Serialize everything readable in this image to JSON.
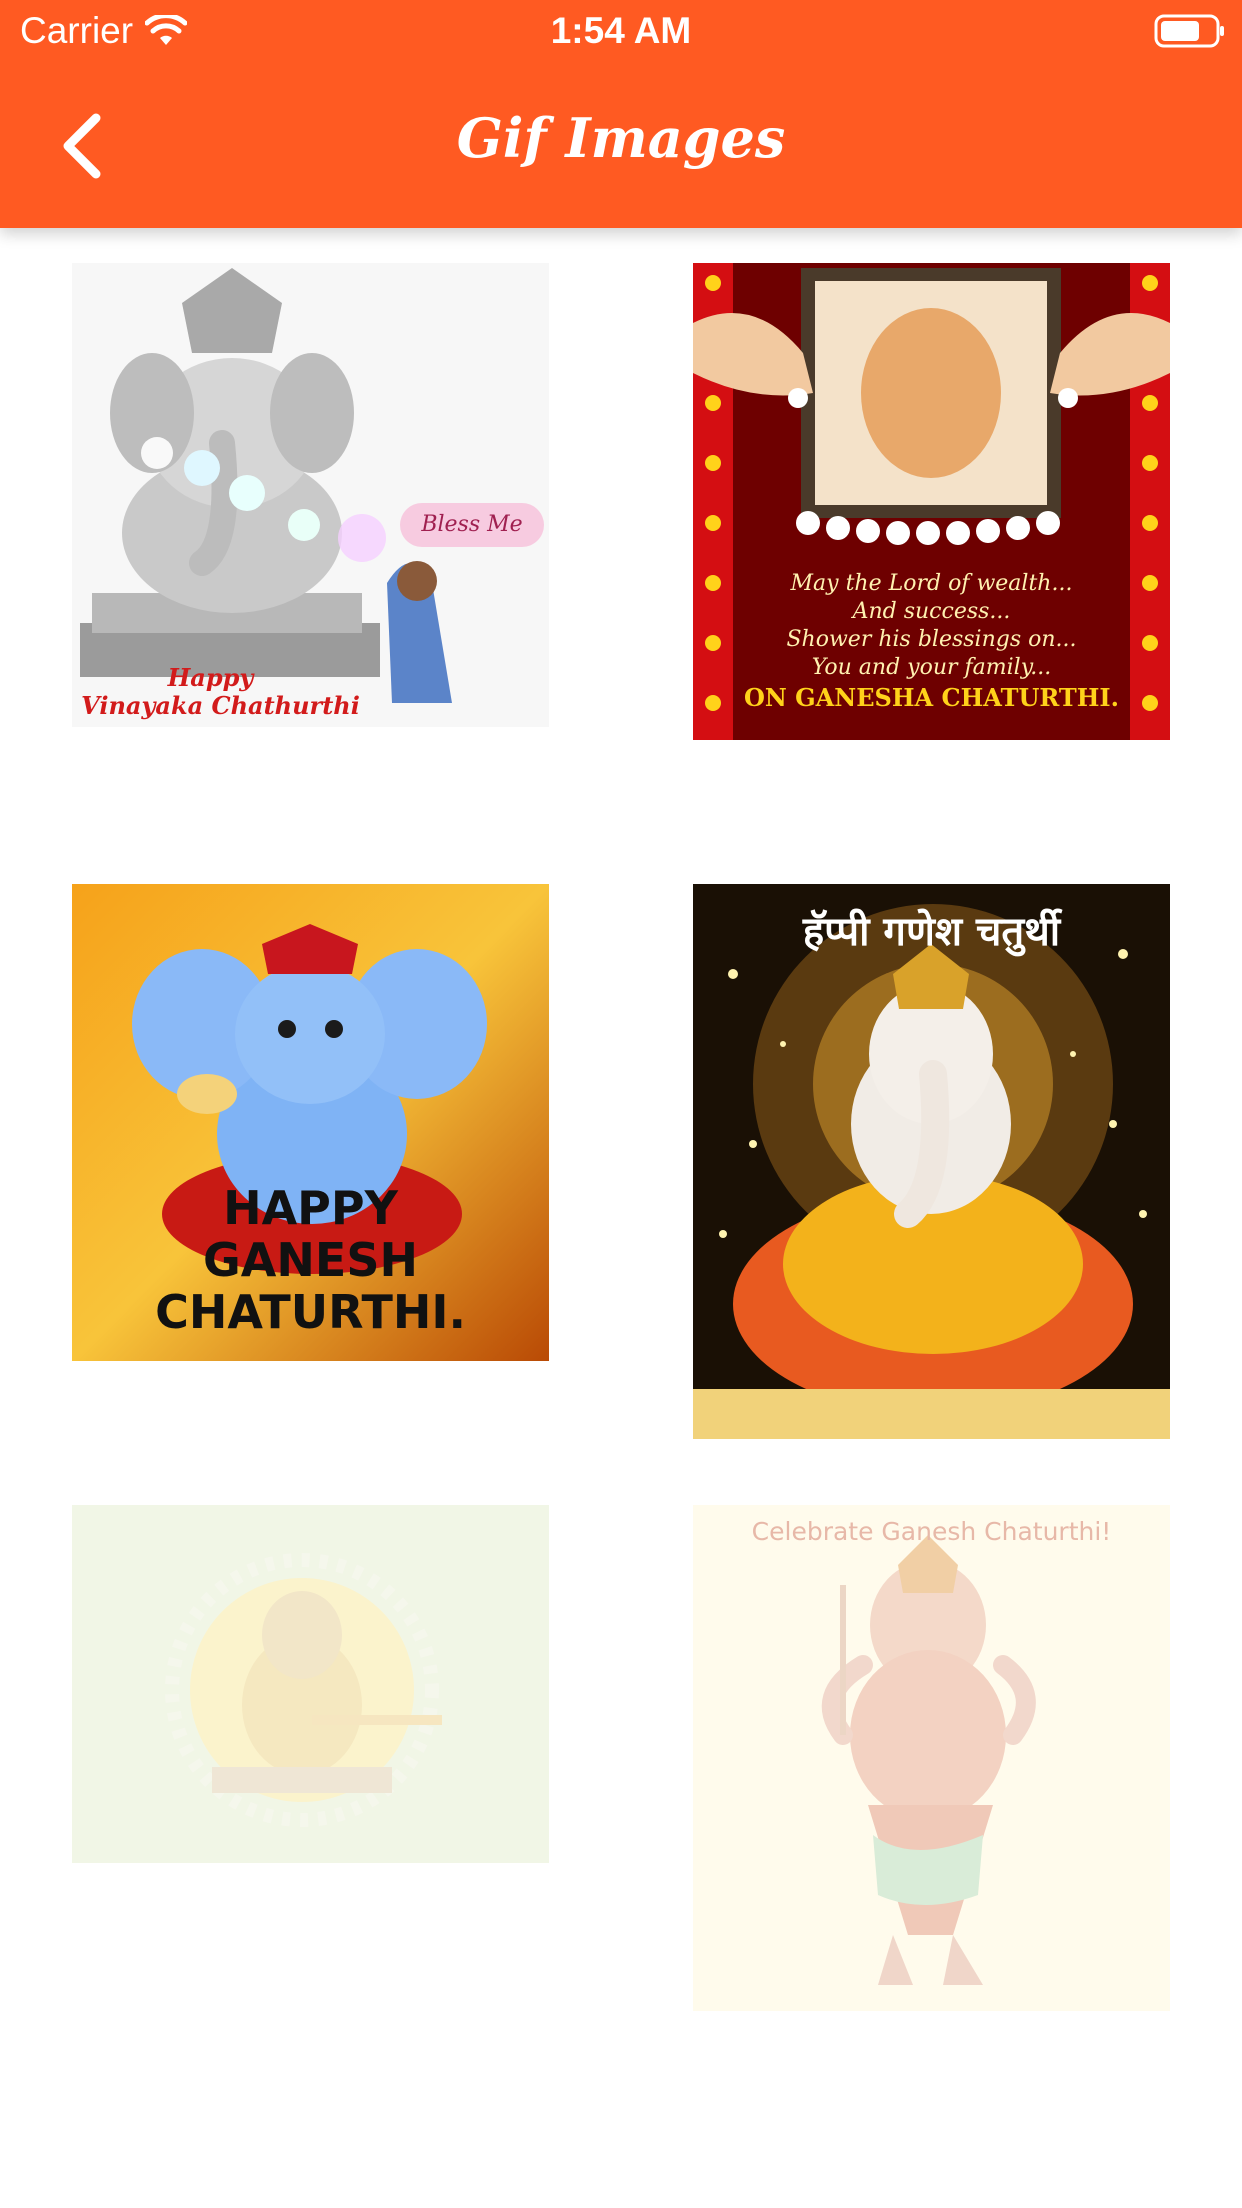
{
  "status_bar": {
    "carrier": "Carrier",
    "time": "1:54 AM",
    "wifi_icon": "wifi-icon",
    "battery_icon": "battery-icon"
  },
  "nav": {
    "title": "Gif Images",
    "back_icon": "chevron-left-icon"
  },
  "colors": {
    "accent": "#FF5A22",
    "background": "#FFFFFF"
  },
  "gallery": {
    "tiles": [
      {
        "bubble": "Bless Me",
        "caption_lines": [
          "Happy",
          "Vinayaka Chathurthi"
        ]
      },
      {
        "message_lines": [
          "May the Lord of wealth...",
          "And success...",
          "Shower his blessings on...",
          "You and your family..."
        ],
        "caption": "ON GANESHA CHATURTHI."
      },
      {
        "caption_lines": [
          "HAPPY",
          "GANESH",
          "CHATURTHI."
        ]
      },
      {
        "caption": "हॅप्पी गणेश चतुर्थी"
      },
      {},
      {
        "caption": "Celebrate Ganesh Chaturthi!"
      }
    ]
  }
}
